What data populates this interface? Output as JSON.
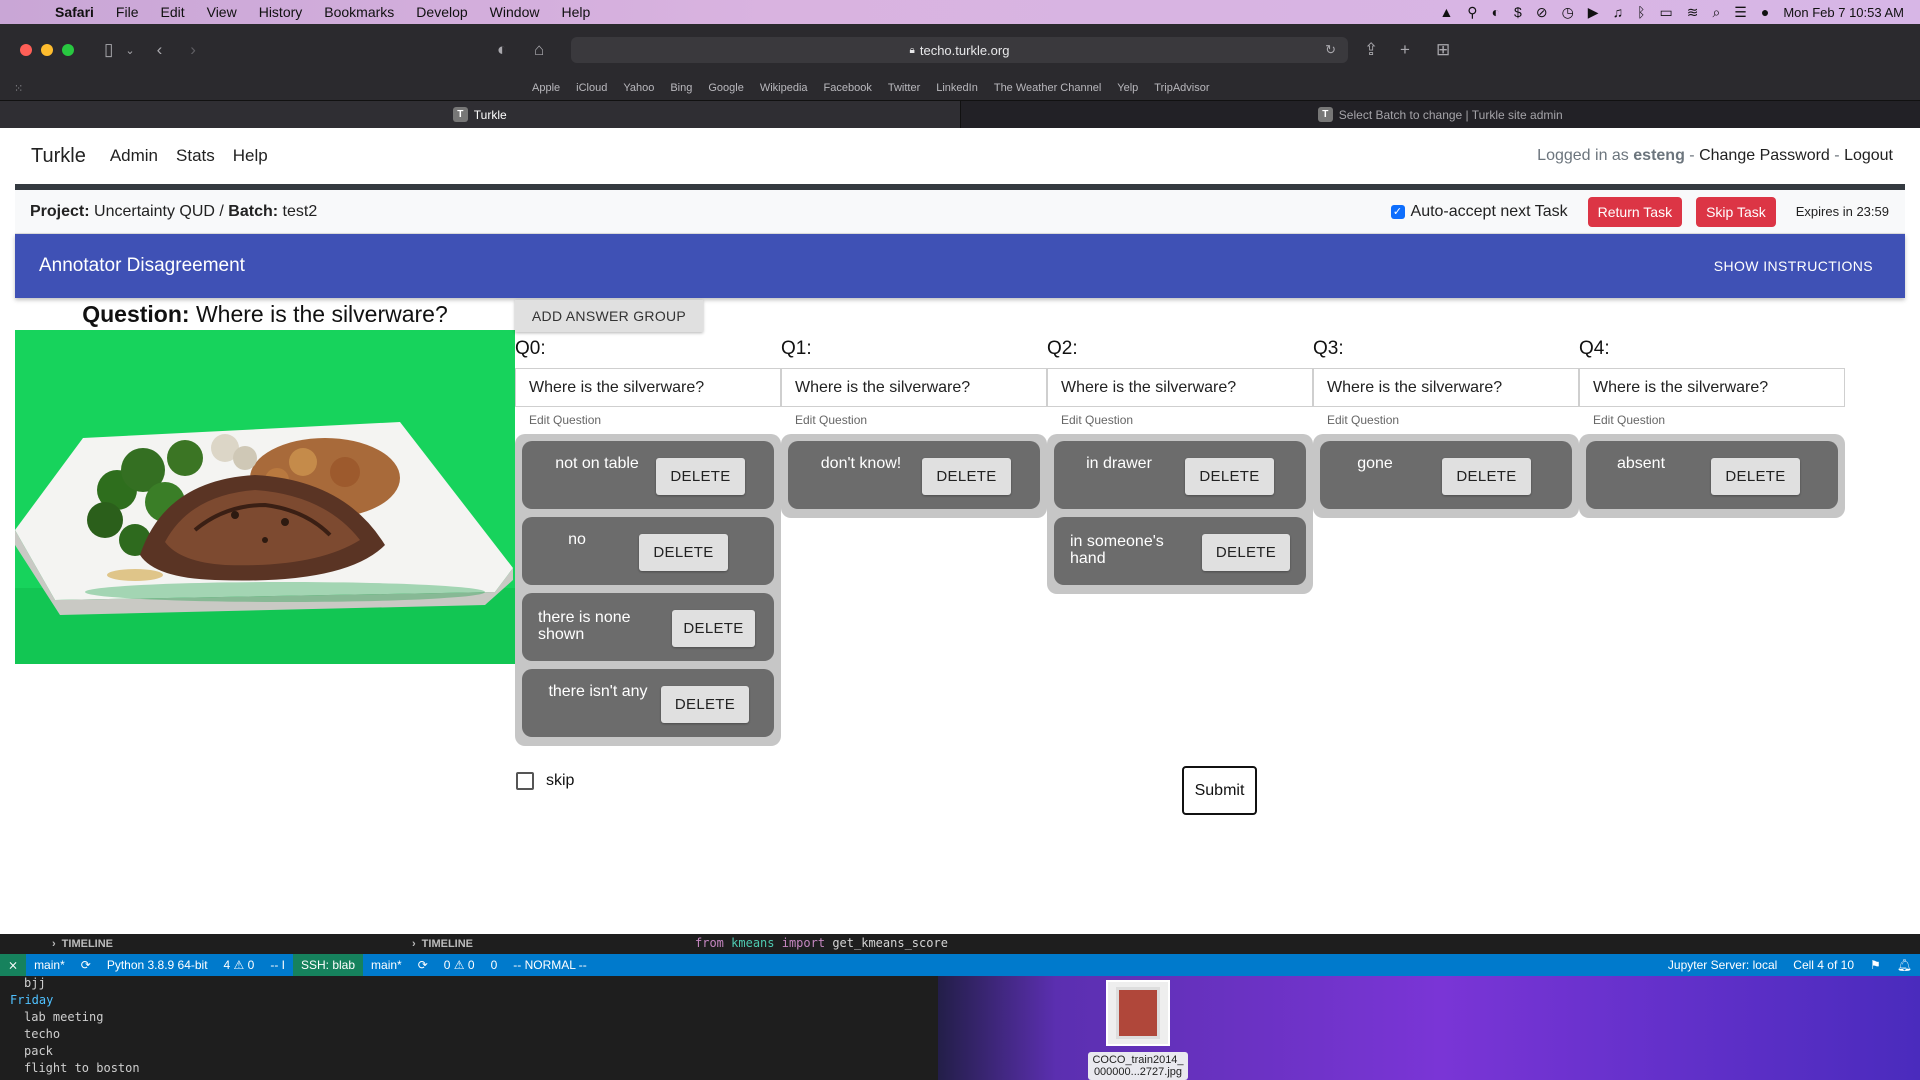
{
  "menubar": {
    "app": "Safari",
    "items": [
      "File",
      "Edit",
      "View",
      "History",
      "Bookmarks",
      "Develop",
      "Window",
      "Help"
    ],
    "clock": "Mon Feb 7  10:53 AM"
  },
  "browser": {
    "url": "techo.turkle.org",
    "favorites": [
      "Apple",
      "iCloud",
      "Yahoo",
      "Bing",
      "Google",
      "Wikipedia",
      "Facebook",
      "Twitter",
      "LinkedIn",
      "The Weather Channel",
      "Yelp",
      "TripAdvisor"
    ],
    "tabs": [
      {
        "label": "Turkle",
        "favicon": "T"
      },
      {
        "label": "Select Batch to change | Turkle site admin",
        "favicon": "T"
      }
    ]
  },
  "nav": {
    "brand": "Turkle",
    "links": [
      "Admin",
      "Stats",
      "Help"
    ],
    "logged_in_prefix": "Logged in as",
    "username": "esteng",
    "change_password": "Change Password",
    "logout": "Logout"
  },
  "batch": {
    "project_label": "Project:",
    "project": "Uncertainty QUD",
    "batch_label": "Batch:",
    "batch": "test2",
    "auto_accept": "Auto-accept next Task",
    "return_task": "Return Task",
    "skip_task": "Skip Task",
    "expires": "Expires in 23:59"
  },
  "banner": {
    "title": "Annotator Disagreement",
    "instructions": "SHOW INSTRUCTIONS"
  },
  "task": {
    "question_label": "Question:",
    "question": "Where is the silverware?",
    "add_group": "ADD ANSWER GROUP",
    "edit_label": "Edit Question",
    "delete_label": "DELETE",
    "groups": [
      {
        "label": "Q0:",
        "question": "Where is the silverware?",
        "answers": [
          "not on table",
          "no",
          "there is none shown",
          "there isn't any"
        ]
      },
      {
        "label": "Q1:",
        "question": "Where is the silverware?",
        "answers": [
          "don't know!"
        ]
      },
      {
        "label": "Q2:",
        "question": "Where is the silverware?",
        "answers": [
          "in drawer",
          "in someone's hand"
        ]
      },
      {
        "label": "Q3:",
        "question": "Where is the silverware?",
        "answers": [
          "gone"
        ]
      },
      {
        "label": "Q4:",
        "question": "Where is the silverware?",
        "answers": [
          "absent"
        ]
      }
    ],
    "skip": "skip",
    "submit": "Submit"
  },
  "vscode": {
    "timeline": "TIMELINE",
    "code_from": "from",
    "code_module": "kmeans",
    "code_import": "import",
    "code_name": "get_kmeans_score",
    "status_left": [
      "main*",
      "Python 3.8.9 64-bit",
      "4 ⚠ 0",
      "-- I"
    ],
    "ssh": "SSH: blab",
    "status_mid": [
      "main*",
      "0 ⚠ 0",
      "0",
      "-- NORMAL --"
    ],
    "status_right": [
      "Jupyter Server: local",
      "Cell 4 of 10"
    ]
  },
  "todo": {
    "lines": [
      "bjj",
      "Friday",
      "lab meeting",
      "techo",
      "pack",
      "flight to boston"
    ]
  },
  "desktop_file": {
    "name_line1": "COCO_train2014_",
    "name_line2": "000000...2727.jpg"
  },
  "colors": {
    "banner": "#3f51b5",
    "danger": "#dc3545",
    "statusbar": "#007acc",
    "image_bg": "#18d45c"
  }
}
